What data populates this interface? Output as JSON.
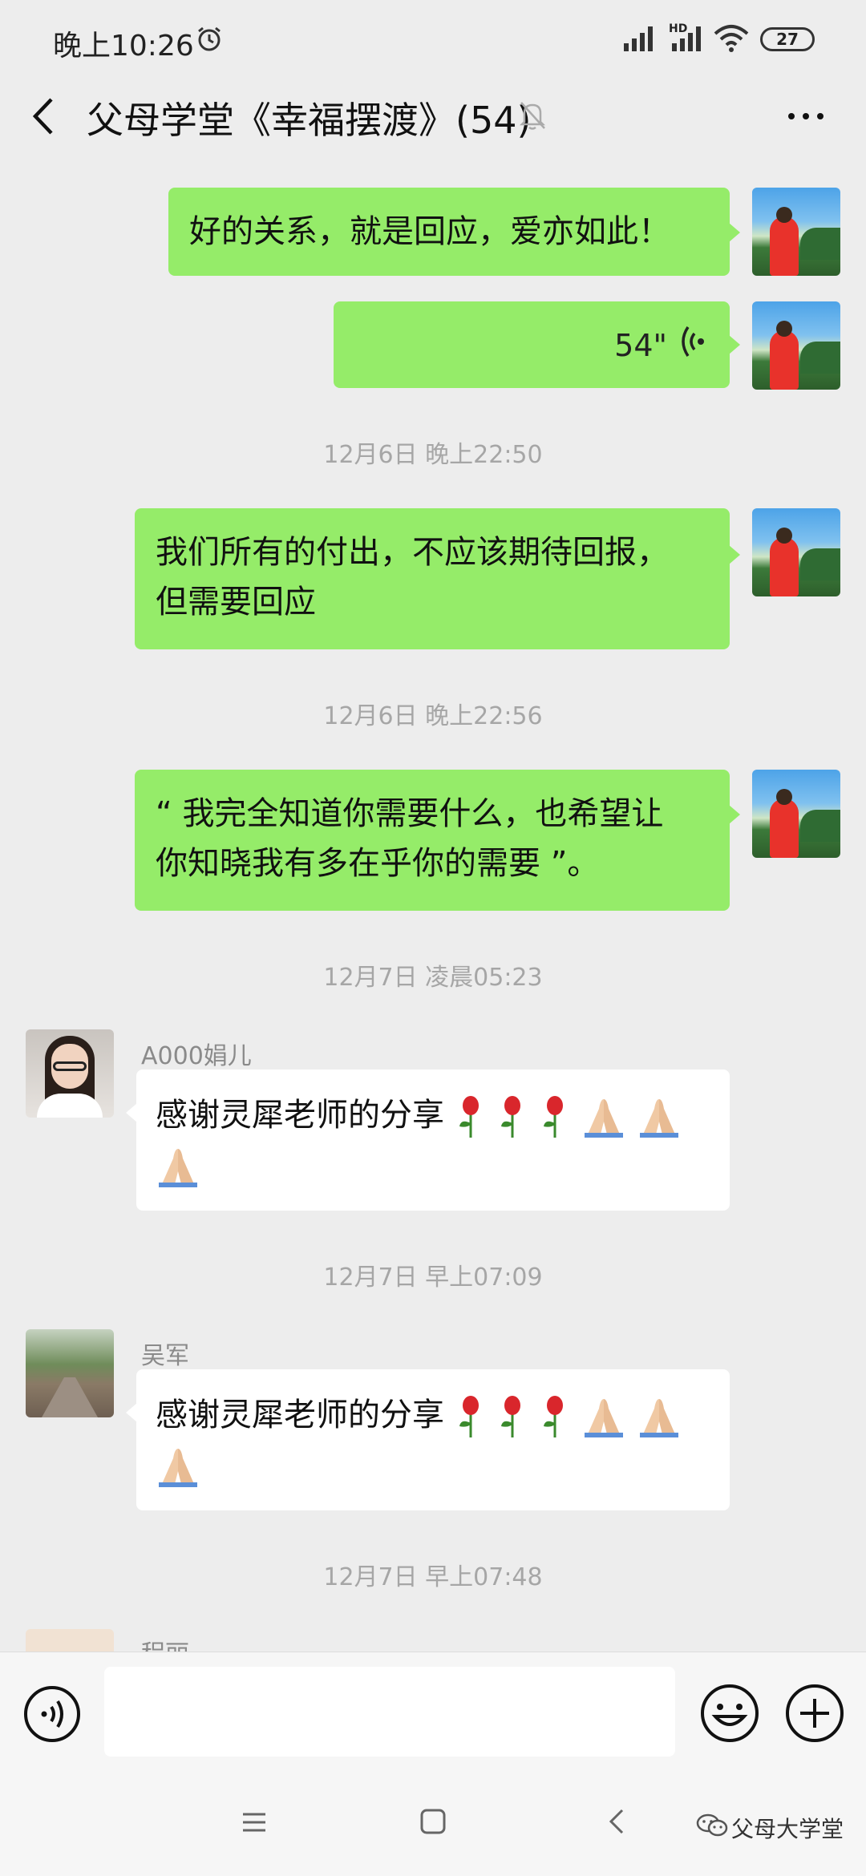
{
  "status_bar": {
    "time": "晚上10:26",
    "battery": "27",
    "network_label": "HD"
  },
  "header": {
    "title": "父母学堂《幸福摆渡》(54)"
  },
  "messages": {
    "m1": {
      "text": "好的关系，就是回应，爱亦如此！"
    },
    "m2": {
      "duration": "54\""
    },
    "ts1": "12月6日 晚上22:50",
    "m3": {
      "line1": "我们所有的付出，不应该期待回报，",
      "line2": "但需要回应"
    },
    "ts2": "12月6日 晚上22:56",
    "m4": {
      "line1": "“ 我完全知道你需要什么，也希望让",
      "line2": "你知晓我有多在乎你的需要 ”。"
    },
    "ts3": "12月7日 凌晨05:23",
    "m5": {
      "sender": "A000娟儿",
      "text": "感谢灵犀老师的分享"
    },
    "ts4": "12月7日 早上07:09",
    "m6": {
      "sender": "吴军",
      "text": "感谢灵犀老师的分享"
    },
    "ts5": "12月7日 早上07:48",
    "m7": {
      "sender": "程丽"
    }
  },
  "input": {
    "value": "",
    "placeholder": ""
  },
  "watermark": "父母大学堂",
  "colors": {
    "outgoing_bubble": "#95ec69",
    "incoming_bubble": "#ffffff",
    "background": "#ededed"
  },
  "icons": [
    "alarm-icon",
    "signal-icon",
    "wifi-icon",
    "back-icon",
    "mute-icon",
    "more-icon",
    "voice-wave-icon",
    "rose-icon",
    "praying-hands-icon",
    "voice-mode-icon",
    "emoji-icon",
    "plus-icon",
    "menu-icon",
    "home-icon",
    "nav-back-icon",
    "wechat-icon"
  ]
}
